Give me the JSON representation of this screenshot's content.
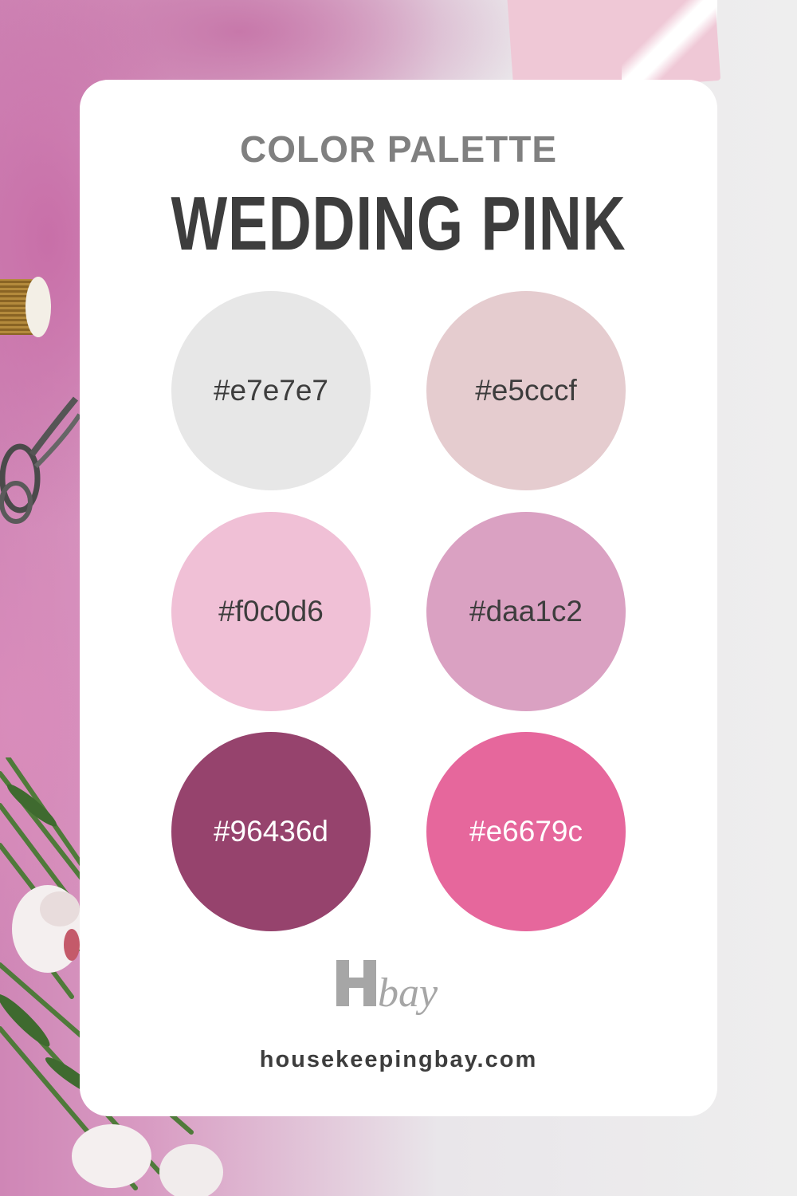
{
  "header": {
    "subtitle": "COLOR PALETTE",
    "title": "WEDDING PINK"
  },
  "swatches": [
    {
      "hex": "#e7e7e7",
      "label": "#e7e7e7",
      "text_color": "#3d3d3d"
    },
    {
      "hex": "#e5cccf",
      "label": "#e5cccf",
      "text_color": "#3d3d3d"
    },
    {
      "hex": "#f0c0d6",
      "label": "#f0c0d6",
      "text_color": "#3d3d3d"
    },
    {
      "hex": "#daa1c2",
      "label": "#daa1c2",
      "text_color": "#3d3d3d"
    },
    {
      "hex": "#96436d",
      "label": "#96436d",
      "text_color": "#ffffff"
    },
    {
      "hex": "#e6679c",
      "label": "#e6679c",
      "text_color": "#ffffff"
    }
  ],
  "brand": {
    "logo_text": "Hbay",
    "website": "housekeepingbay.com"
  },
  "colors": {
    "card": "#ffffff",
    "title": "#3d3d3d",
    "subtitle": "#808080",
    "logo": "#a6a6a6"
  }
}
